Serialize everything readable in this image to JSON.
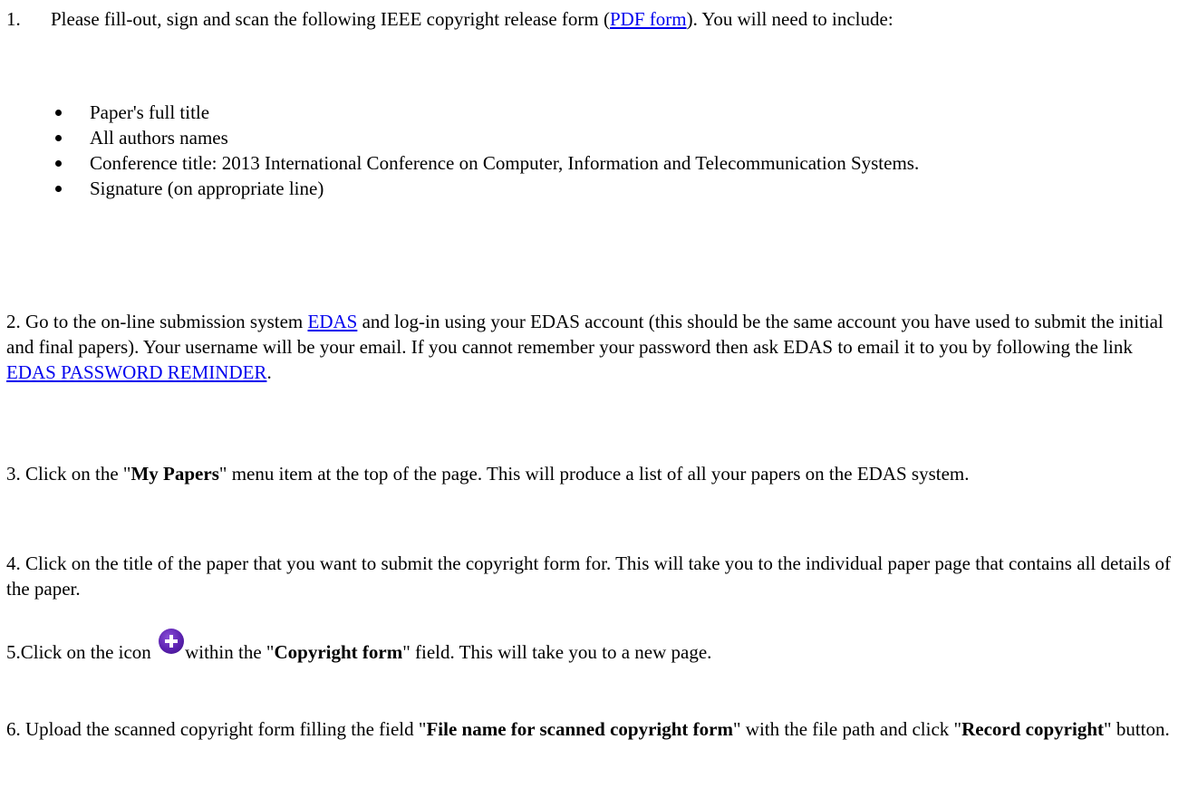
{
  "step1": {
    "number": "1.",
    "text_before_link": "Please fill-out, sign and scan the following IEEE copyright release form (",
    "link_label": "PDF form",
    "text_after_link": "). You will need to include:",
    "requirements": [
      "Paper's full title",
      "All authors names",
      "Conference title: 2013 International Conference on Computer, Information and Telecommunication Systems.",
      "Signature (on appropriate line)"
    ]
  },
  "step2": {
    "text_before_link": "2.  Go to the on-line submission system ",
    "edas_link_label": "EDAS",
    "text_middle": "  and log-in using your EDAS account (this should be the same account you have used to submit the initial and final papers). Your username will be your email. If you cannot remember your password then ask EDAS to email it to you by following the link ",
    "reminder_link_label": "EDAS PASSWORD REMINDER",
    "text_after": "."
  },
  "step3": {
    "text_before": "3. Click on the \"",
    "bold": "My Papers",
    "text_after": "\" menu item at the top of the page. This will produce a list of all your papers on the EDAS system."
  },
  "step4": {
    "text": "4. Click on the title of the paper that you want to submit the copyright form for. This will take you to the individual paper page that contains all details of the paper."
  },
  "step5": {
    "text_before": "5.Click on the icon ",
    "icon": "add-circle-icon",
    "icon_color": "#5b22b0",
    "text_middle": "within the \"",
    "bold": "Copyright form",
    "text_after": "\" field. This will take you to a new page."
  },
  "step6": {
    "text_before": "6. Upload the scanned copyright form filling the field \"",
    "bold1": "File name for scanned copyright form",
    "text_middle": "\" with the file path and click \"",
    "bold2": "Record copyright",
    "text_after": "\" button."
  },
  "colors": {
    "link": "#0000ee",
    "text": "#000000",
    "background": "#ffffff"
  }
}
